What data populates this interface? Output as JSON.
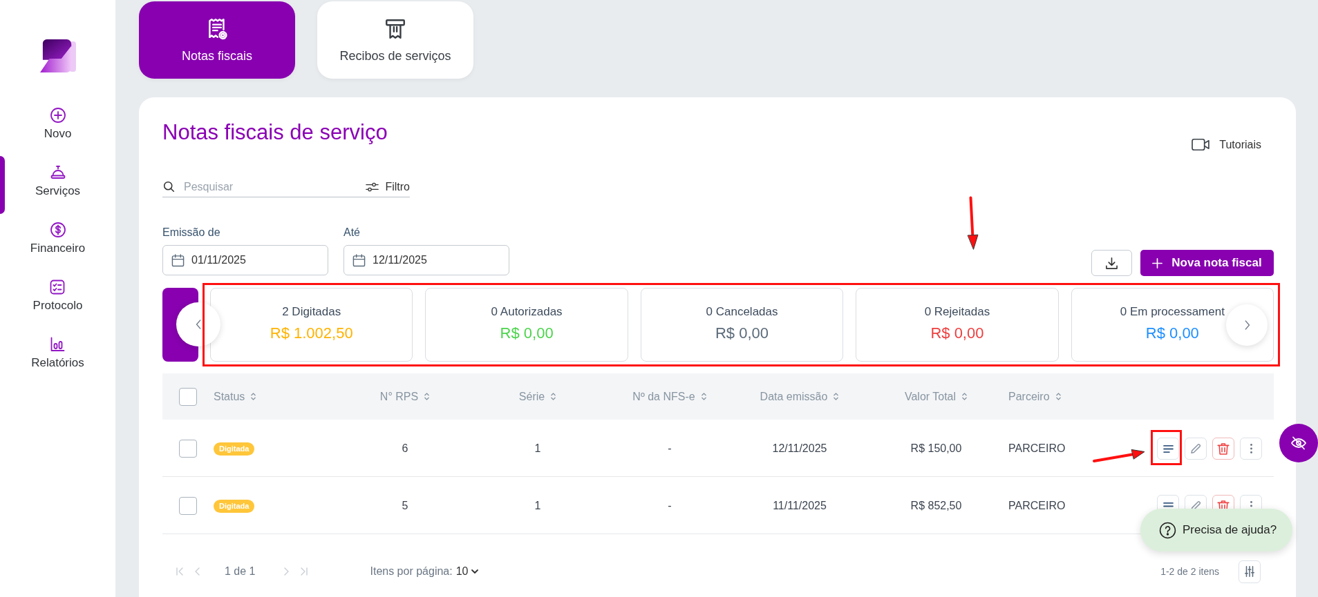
{
  "sidebar": {
    "items": [
      {
        "label": "Novo",
        "selected": false
      },
      {
        "label": "Serviços",
        "selected": true
      },
      {
        "label": "Financeiro",
        "selected": false
      },
      {
        "label": "Protocolo",
        "selected": false
      },
      {
        "label": "Relatórios",
        "selected": false
      }
    ]
  },
  "tabs": [
    {
      "label": "Notas fiscais",
      "selected": true
    },
    {
      "label": "Recibos de serviços",
      "selected": false
    }
  ],
  "header": {
    "title": "Notas fiscais de serviço",
    "tutorials_link": "Tutoriais"
  },
  "search": {
    "placeholder": "Pesquisar",
    "filter_button": "Filtro"
  },
  "date_range": [
    {
      "label": "Emissão de",
      "value": "01/11/2025"
    },
    {
      "label": "Até",
      "value": "12/11/2025"
    }
  ],
  "toolbar": {
    "new_button": "Nova nota fiscal"
  },
  "summary": {
    "highlighted": true,
    "cards": [
      {
        "label": "2 Digitadas",
        "amount": "R$ 1.002,50",
        "color": "#ffb300"
      },
      {
        "label": "0 Autorizadas",
        "amount": "R$ 0,00",
        "color": "#4cd44c"
      },
      {
        "label": "0 Canceladas",
        "amount": "R$ 0,00",
        "color": "#5c6b7a"
      },
      {
        "label": "0 Rejeitadas",
        "amount": "R$ 0,00",
        "color": "#ee3e3e"
      },
      {
        "label": "0 Em processament",
        "amount": "R$ 0,00",
        "color": "#1e8fff"
      }
    ]
  },
  "table": {
    "header_checked": false,
    "columns": [
      "Status",
      "N° RPS",
      "Série",
      "Nº da NFS-e",
      "Data emissão",
      "Valor Total",
      "Parceiro"
    ],
    "rows": [
      {
        "checked": false,
        "status": "Digitada",
        "rps": "6",
        "serie": "1",
        "nfse": "-",
        "date": "12/11/2025",
        "total": "R$ 150,00",
        "partner": "PARCEIRO",
        "highlighted": true
      },
      {
        "checked": false,
        "status": "Digitada",
        "rps": "5",
        "serie": "1",
        "nfse": "-",
        "date": "11/11/2025",
        "total": "R$ 852,50",
        "partner": "PARCEIRO",
        "highlighted": false
      }
    ]
  },
  "pagination": {
    "nav": [
      {
        "kind": "first",
        "disabled": true
      },
      {
        "kind": "prev",
        "disabled": true
      },
      {
        "kind": "next",
        "disabled": true
      },
      {
        "kind": "last",
        "disabled": true
      }
    ],
    "page_label": "1 de 1",
    "per_page_label": "Itens por página:",
    "per_page_value": "10",
    "range_label": "1-2 de 2 itens"
  },
  "help": {
    "label": "Precisa de ajuda?"
  }
}
